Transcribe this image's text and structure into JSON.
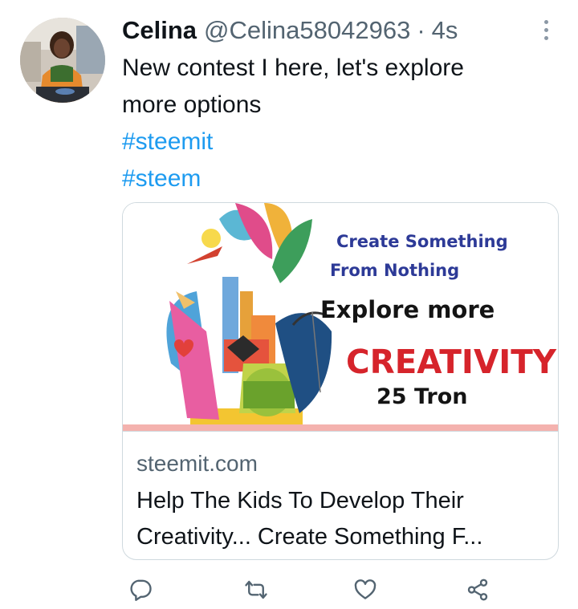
{
  "tweet": {
    "display_name": "Celina",
    "handle": "@Celina58042963",
    "separator": "·",
    "time": "4s",
    "text_lines": [
      "New contest I here, let's explore",
      "more options"
    ],
    "hashtags": [
      "#steemit",
      "#steem"
    ]
  },
  "card": {
    "image": {
      "line1": "Create Something",
      "line2": "From Nothing",
      "line3": "Explore more",
      "line4": "CREATIVITY",
      "line5": "25 Tron"
    },
    "domain": "steemit.com",
    "title_lines": [
      "Help The Kids To Develop Their",
      "Creativity... Create Something F..."
    ]
  },
  "actions": {
    "icons": [
      "reply-icon",
      "retweet-icon",
      "like-icon",
      "share-icon"
    ]
  },
  "colors": {
    "link": "#1d9bf0",
    "secondary_text": "#536471",
    "border": "#cfd9de",
    "image_headline_blue": "#2d3a97",
    "image_headline_red": "#d6242b"
  }
}
